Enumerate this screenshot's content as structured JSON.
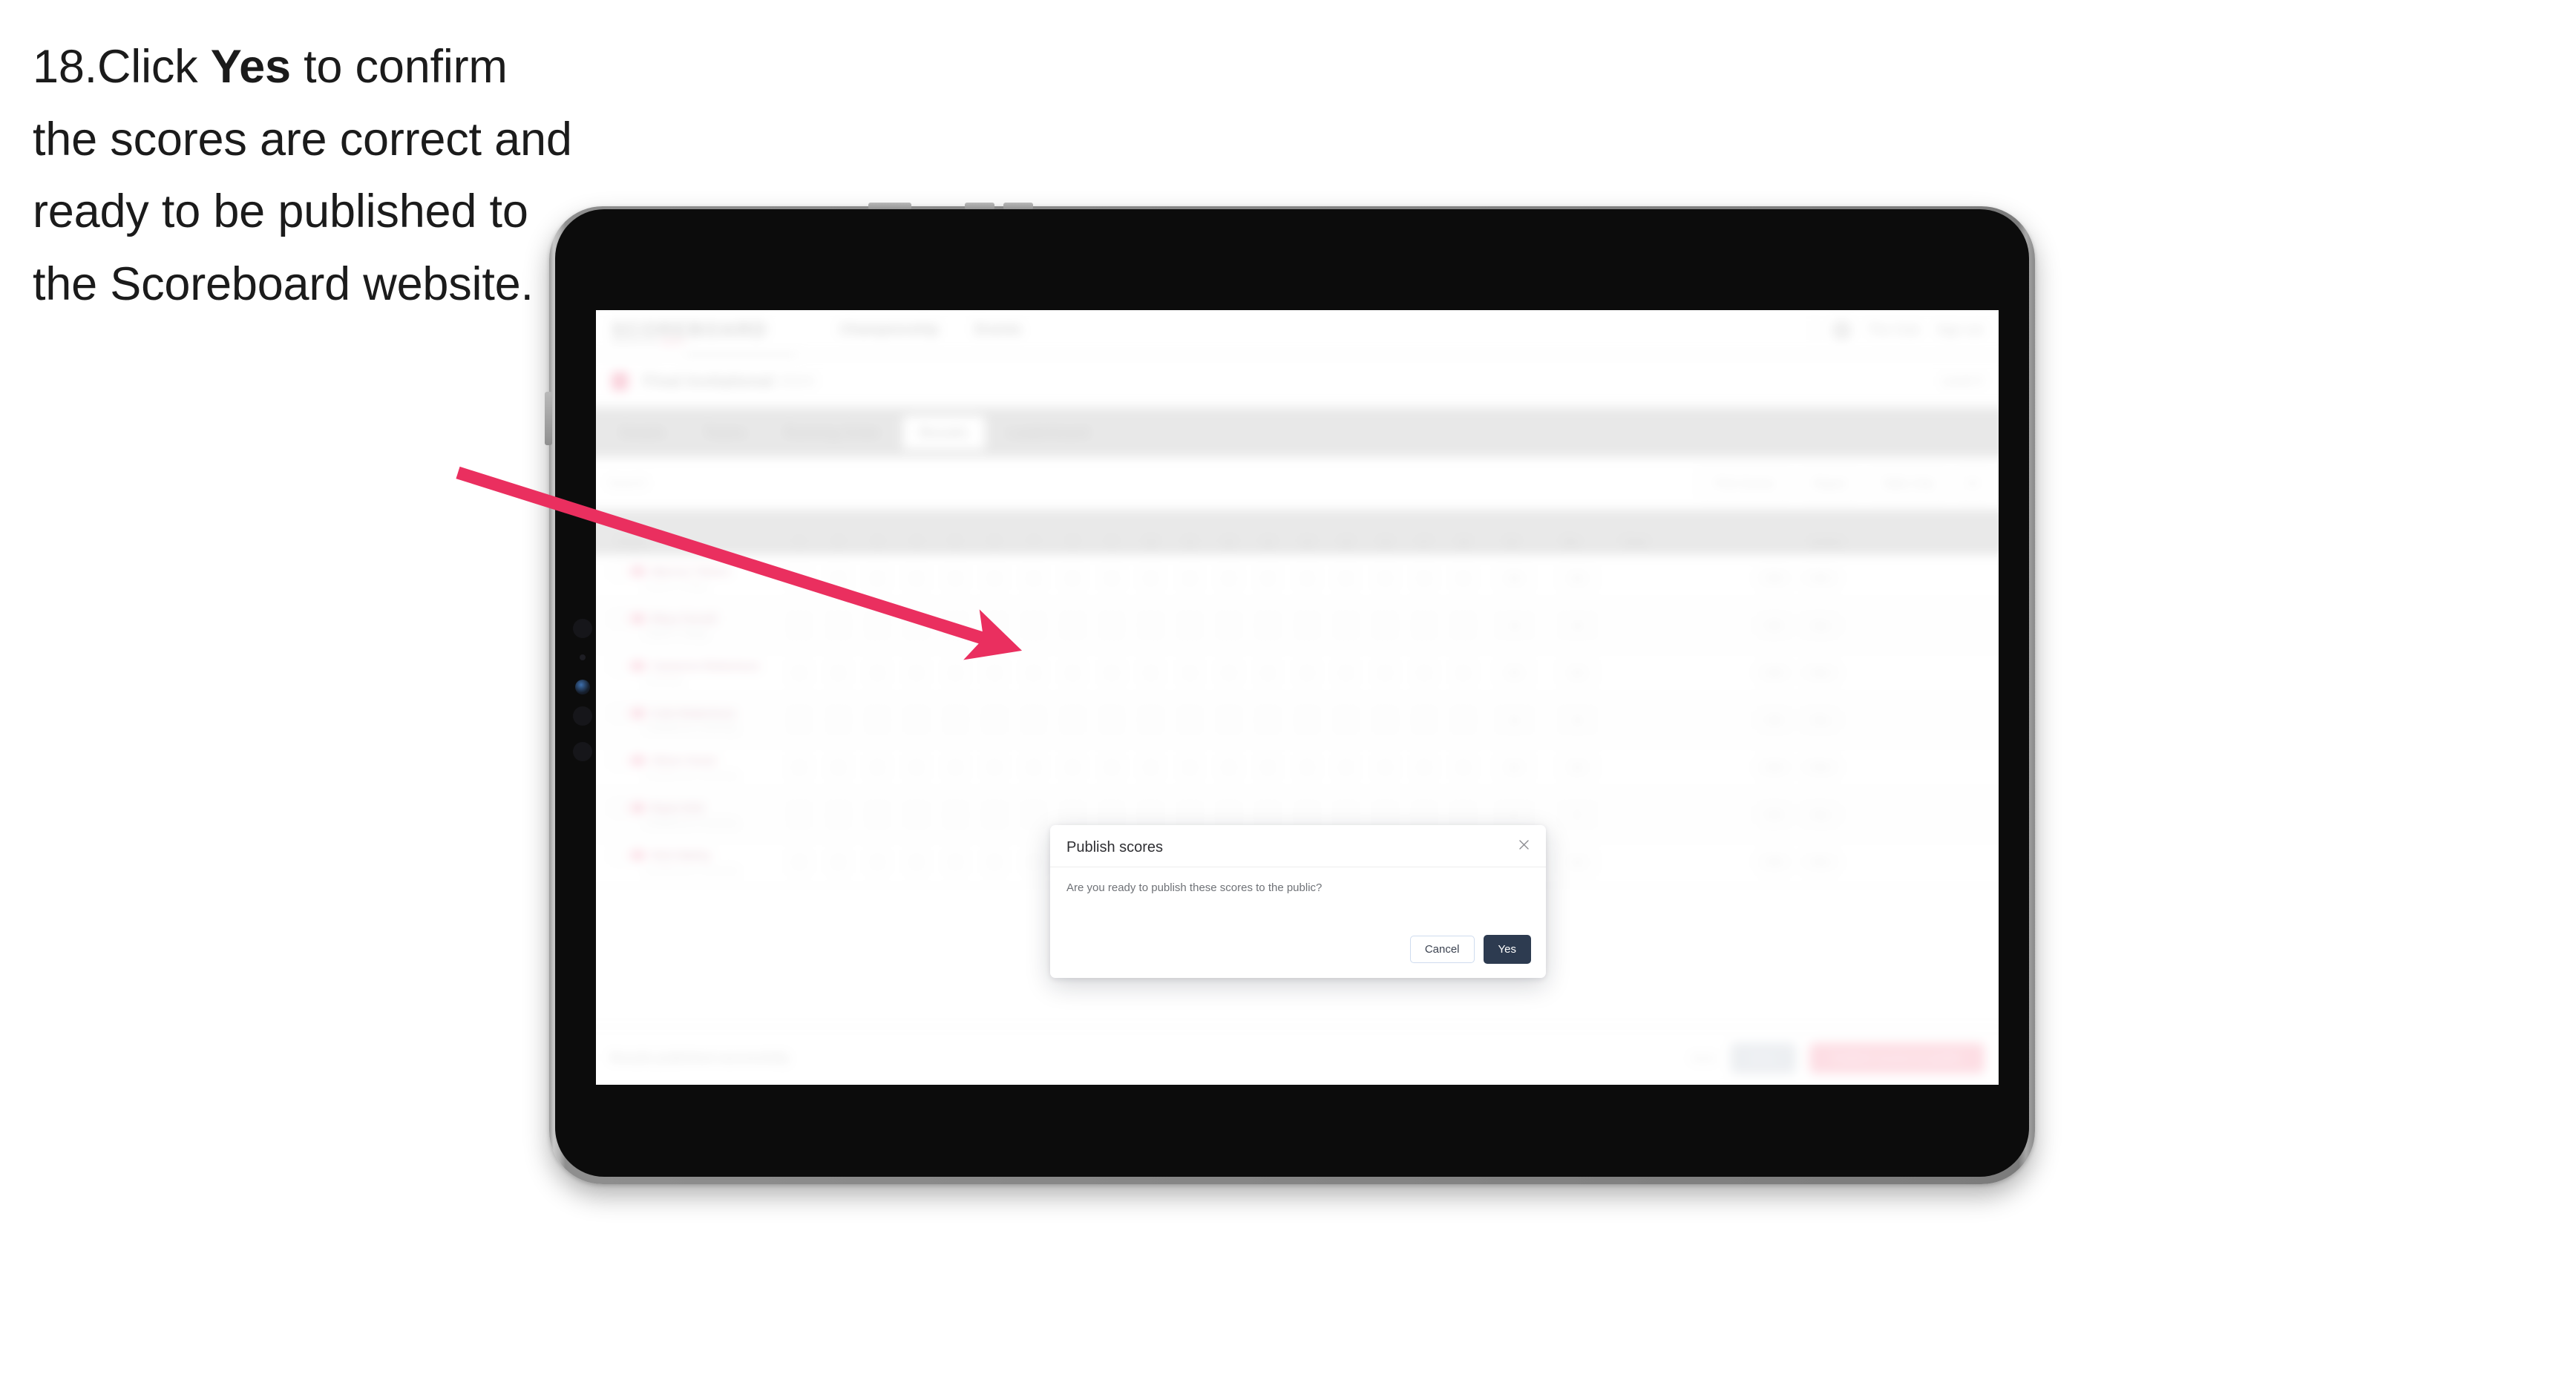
{
  "instruction": {
    "number": "18.",
    "part1": "Click ",
    "emphasis": "Yes",
    "part2": " to confirm the scores are correct and ready to be published to the Scoreboard website."
  },
  "colors": {
    "arrow": "#ea2f5f",
    "primary_button": "#2d3b50",
    "cancel_border": "#cfdcef",
    "brand_pink": "#f5aec0"
  },
  "modal": {
    "title": "Publish scores",
    "message": "Are you ready to publish these scores to the public?",
    "cancel_label": "Cancel",
    "confirm_label": "Yes",
    "close_icon": "close-icon"
  },
  "app": {
    "nav": {
      "logo": "SCOREBOARD",
      "logo_sub": "powered by ",
      "logo_sub_brand": "Sport",
      "links": [
        "Championship",
        "Events"
      ],
      "user": "The Club",
      "signout": "Sign out"
    },
    "competition": {
      "title": "Final Invitational",
      "muted": "2024",
      "right": "Level 3"
    },
    "tabs": [
      {
        "label": "Details",
        "active": false
      },
      {
        "label": "Teams",
        "active": false
      },
      {
        "label": "Running Order",
        "active": false
      },
      {
        "label": "Results",
        "active": true
      },
      {
        "label": "Leaderboard",
        "active": false
      }
    ],
    "filters": {
      "search_placeholder": "Search",
      "buttons": [
        "Print Scores",
        "Report",
        "Table Only"
      ]
    },
    "table": {
      "columns": [
        "Player",
        "1",
        "2",
        "3",
        "4",
        "5",
        "6",
        "7",
        "8",
        "9",
        "10",
        "11",
        "12",
        "13",
        "14",
        "15",
        "16",
        "17",
        "18",
        "19",
        "Pts",
        "Total",
        "Action"
      ],
      "rows": [
        {
          "name": "Marcus Tolson",
          "club": "Eastern College",
          "scores": [
            "0",
            "0",
            "0",
            "0",
            "0",
            "0",
            "0",
            "0",
            "0",
            "0",
            "0",
            "0",
            "0",
            "0",
            "0",
            "0",
            "0",
            "0"
          ],
          "pts": "96",
          "total": "96",
          "actions": [
            "Edit",
            "View"
          ]
        },
        {
          "name": "Rhys Ferrell",
          "club": "Eastern College",
          "scores": [
            "0",
            "0",
            "0",
            "0",
            "0",
            "0",
            "0",
            "0",
            "0",
            "0",
            "0",
            "0",
            "0",
            "0",
            "0",
            "0",
            "0",
            "0"
          ],
          "pts": "98",
          "total": "98",
          "actions": [
            "Edit",
            "View"
          ]
        },
        {
          "name": "Cameron Robertson",
          "club": "Northside",
          "scores": [
            "0",
            "0",
            "0",
            "0",
            "0",
            "0",
            "0",
            "0",
            "0",
            "0",
            "0",
            "0",
            "0",
            "0",
            "0",
            "0",
            "0",
            "0"
          ],
          "pts": "95",
          "total": "95",
          "actions": [
            "Edit",
            "View"
          ]
        },
        {
          "name": "Cole Robertson",
          "club": "Southbourne University",
          "scores": [
            "0",
            "0",
            "0",
            "0",
            "0",
            "0",
            "0",
            "0",
            "0",
            "0",
            "0",
            "0",
            "0",
            "0",
            "0",
            "0",
            "0",
            "0"
          ],
          "pts": "99",
          "total": "99",
          "actions": [
            "Edit",
            "View"
          ]
        },
        {
          "name": "Oliver Grant",
          "club": "Southbourne University",
          "scores": [
            "0",
            "0",
            "0",
            "0",
            "0",
            "0",
            "0",
            "0",
            "0",
            "0",
            "0",
            "0",
            "0",
            "0",
            "0",
            "0",
            "0",
            "0"
          ],
          "pts": "94",
          "total": "94",
          "actions": [
            "Edit",
            "View"
          ]
        },
        {
          "name": "Ryan Kirk",
          "club": "Southbourne University",
          "scores": [
            "0",
            "0",
            "0",
            "0",
            "0",
            "0",
            "0",
            "0",
            "0",
            "0",
            "0",
            "0",
            "0",
            "0",
            "0",
            "0",
            "0",
            "0"
          ],
          "pts": "97",
          "total": "97",
          "actions": [
            "Edit",
            "View"
          ]
        },
        {
          "name": "Nick Bailey",
          "club": "Southbourne University",
          "scores": [
            "0",
            "0",
            "0",
            "0",
            "0",
            "0",
            "0",
            "0",
            "0",
            "0",
            "0",
            "0",
            "0",
            "0",
            "0",
            "0",
            "0",
            "0"
          ],
          "pts": "93",
          "total": "93",
          "actions": [
            "Edit",
            "View"
          ]
        }
      ]
    },
    "footer": {
      "note": "Results published successfully",
      "link": "Back",
      "grey_button": "Save",
      "pink_button": "Publish scores to public"
    }
  }
}
